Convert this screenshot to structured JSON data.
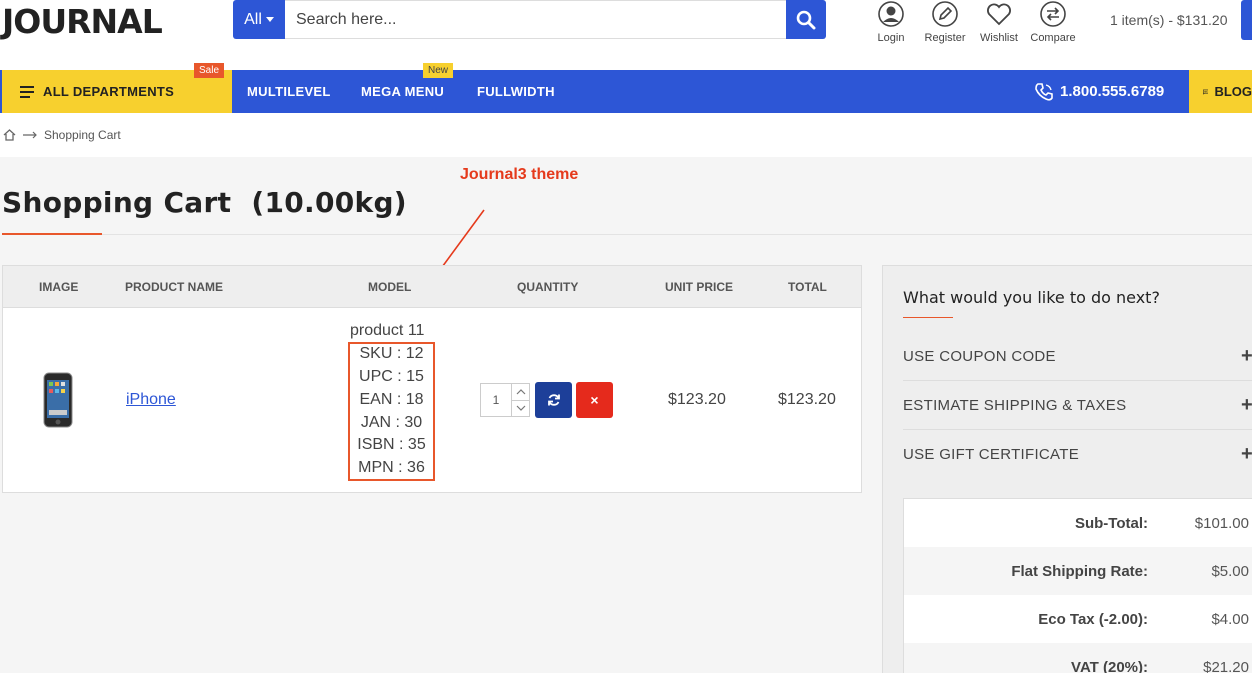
{
  "header": {
    "logo": "JOURNAL",
    "search_category": "All",
    "search_placeholder": "Search here...",
    "icons": [
      {
        "label": "Login",
        "icon": "user-icon"
      },
      {
        "label": "Register",
        "icon": "pencil-icon"
      },
      {
        "label": "Wishlist",
        "icon": "heart-icon"
      },
      {
        "label": "Compare",
        "icon": "compare-icon"
      }
    ],
    "cart_summary": "1 item(s) - $131.20"
  },
  "nav": {
    "departments": "ALL DEPARTMENTS",
    "sale_badge": "Sale",
    "new_badge": "New",
    "items": [
      "MULTILEVEL",
      "MEGA MENU",
      "FULLWIDTH"
    ],
    "phone": "1.800.555.6789",
    "blog": "BLOG"
  },
  "breadcrumb": {
    "current": "Shopping Cart"
  },
  "page": {
    "title": "Shopping Cart  (10.00kg)"
  },
  "annotation": "Journal3 theme",
  "cart_table": {
    "headers": {
      "image": "IMAGE",
      "name": "PRODUCT NAME",
      "model": "MODEL",
      "quantity": "QUANTITY",
      "unit_price": "UNIT PRICE",
      "total": "TOTAL"
    },
    "row": {
      "name": "iPhone",
      "model": "product 11",
      "details": [
        "SKU : 12",
        "UPC : 15",
        "EAN : 18",
        "JAN : 30",
        "ISBN : 35",
        "MPN : 36"
      ],
      "quantity": "1",
      "unit_price": "$123.20",
      "total": "$123.20",
      "remove_label": "×"
    }
  },
  "next_panel": {
    "title": "What would you like to do next?",
    "items": [
      "USE COUPON CODE",
      "ESTIMATE SHIPPING & TAXES",
      "USE GIFT CERTIFICATE"
    ],
    "plus": "+"
  },
  "totals": [
    {
      "label": "Sub-Total:",
      "value": "$101.00"
    },
    {
      "label": "Flat Shipping Rate:",
      "value": "$5.00"
    },
    {
      "label": "Eco Tax (-2.00):",
      "value": "$4.00"
    },
    {
      "label": "VAT (20%):",
      "value": "$21.20"
    }
  ],
  "colors": {
    "primary": "#2d56d6",
    "accent_yellow": "#f7d02e",
    "accent_orange": "#e8572b",
    "danger": "#e52a1c",
    "update_button": "#1d3f99"
  }
}
